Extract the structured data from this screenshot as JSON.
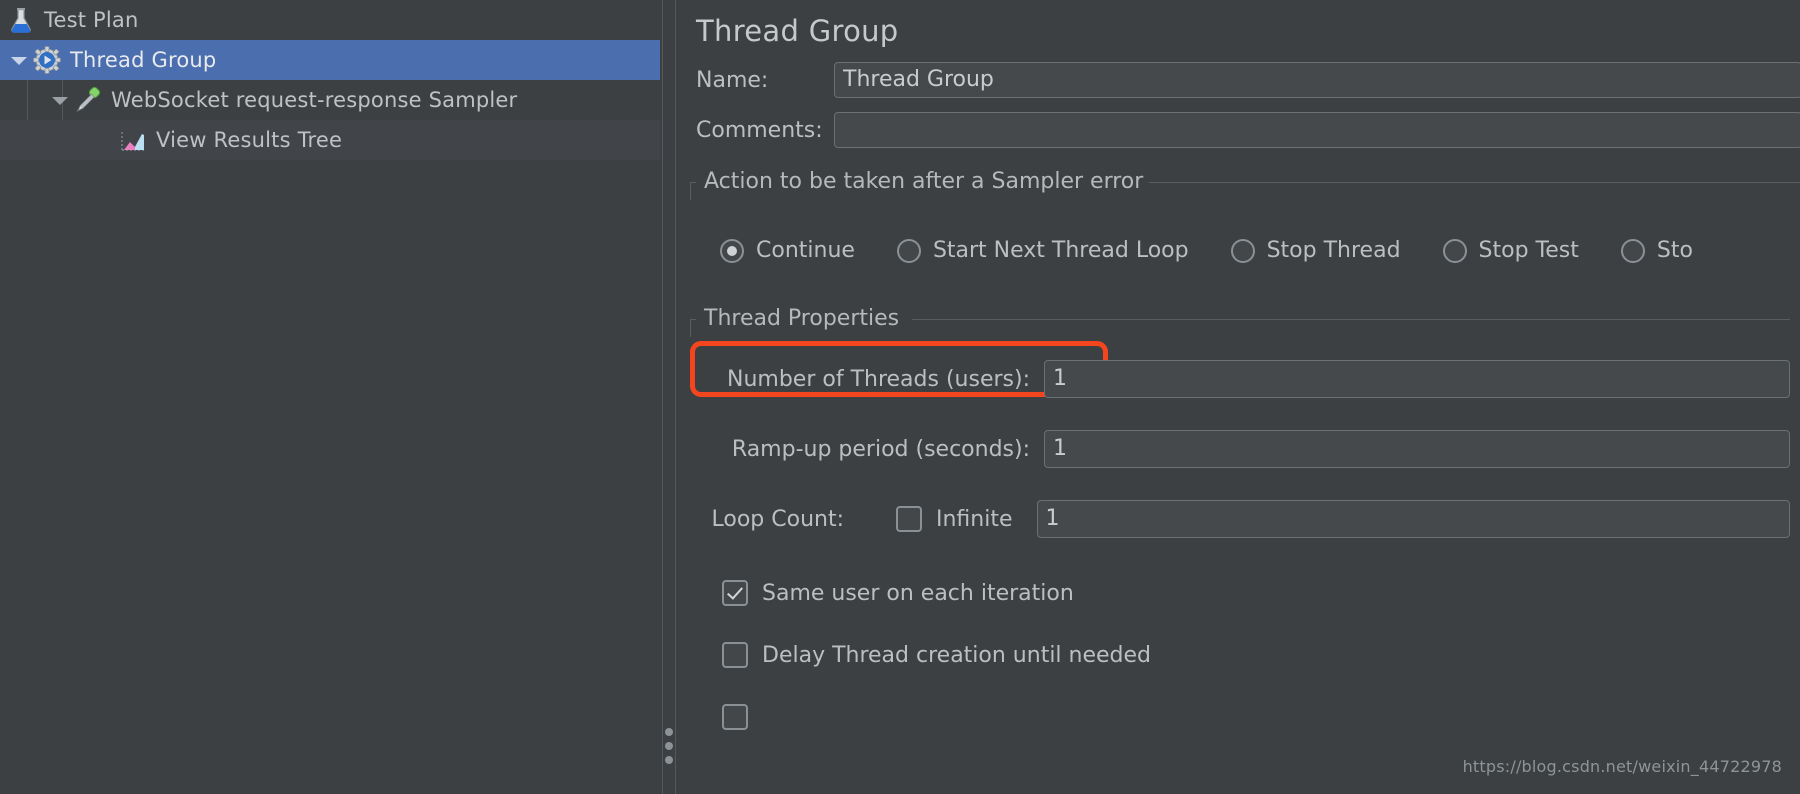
{
  "tree": {
    "items": [
      {
        "label": "Test Plan",
        "icon": "flask-icon",
        "depth": 0,
        "selected": false,
        "expandable": false,
        "expanded": false
      },
      {
        "label": "Thread Group",
        "icon": "gear-icon",
        "depth": 1,
        "selected": true,
        "expandable": true,
        "expanded": true
      },
      {
        "label": "WebSocket request-response Sampler",
        "icon": "pipette-icon",
        "depth": 2,
        "selected": false,
        "expandable": true,
        "expanded": true
      },
      {
        "label": "View Results Tree",
        "icon": "chart-icon",
        "depth": 3,
        "selected": false,
        "expandable": false,
        "expanded": false
      }
    ]
  },
  "panel": {
    "title": "Thread Group",
    "name_label": "Name:",
    "name_value": "Thread Group",
    "comments_label": "Comments:",
    "comments_value": ""
  },
  "sampler_error": {
    "group_title": "Action to be taken after a Sampler error",
    "options": [
      {
        "label": "Continue",
        "selected": true
      },
      {
        "label": "Start Next Thread Loop",
        "selected": false
      },
      {
        "label": "Stop Thread",
        "selected": false
      },
      {
        "label": "Stop Test",
        "selected": false
      },
      {
        "label": "Sto",
        "selected": false
      }
    ]
  },
  "thread_properties": {
    "group_title": "Thread Properties",
    "threads_label": "Number of Threads (users):",
    "threads_value": "1",
    "rampup_label": "Ramp-up period (seconds):",
    "rampup_value": "1",
    "loop_label": "Loop Count:",
    "infinite_label": "Infinite",
    "infinite_checked": false,
    "loop_value": "1",
    "same_user_label": "Same user on each iteration",
    "same_user_checked": true,
    "delay_label": "Delay Thread creation until needed",
    "delay_checked": false
  },
  "annotation": {
    "highlight_color": "#f4461e",
    "target": "Number of Threads (users)"
  },
  "watermark": "https://blog.csdn.net/weixin_44722978",
  "colors": {
    "background": "#3c4043",
    "selection": "#4b6eaf",
    "field_background": "#45494c",
    "text": "#bcbfc1",
    "accent_red": "#f4461e"
  }
}
